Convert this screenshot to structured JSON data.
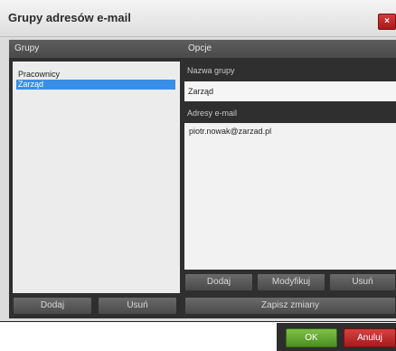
{
  "dialog": {
    "title": "Grupy adresów e-mail",
    "close_label": "×"
  },
  "groups_panel": {
    "header": "Grupy",
    "items": [
      {
        "label": "Pracownicy",
        "selected": false
      },
      {
        "label": "Zarząd",
        "selected": true
      }
    ],
    "add_button": "Dodaj",
    "remove_button": "Usuń"
  },
  "options_panel": {
    "header": "Opcje",
    "group_name_label": "Nazwa grupy",
    "group_name_value": "Zarząd",
    "emails_label": "Adresy e-mail",
    "emails_value": "piotr.nowak@zarzad.pl",
    "add_button": "Dodaj",
    "modify_button": "Modyfikuj",
    "remove_button": "Usuń",
    "save_button": "Zapisz zmiany"
  },
  "footer": {
    "ok_button": "OK",
    "cancel_button": "Anuluj"
  }
}
